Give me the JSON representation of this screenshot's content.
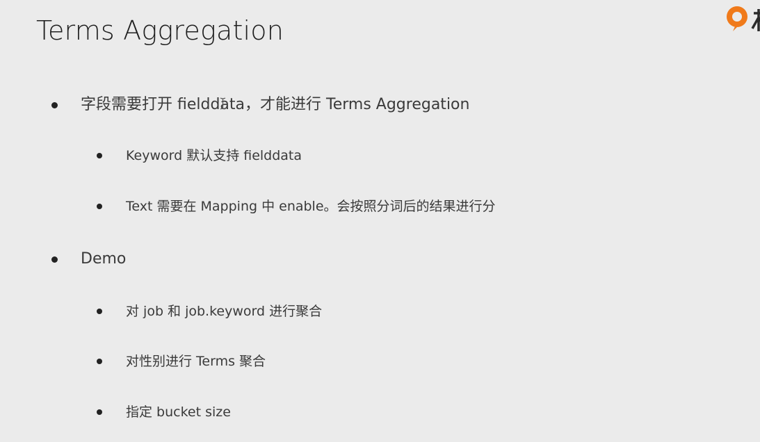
{
  "slide": {
    "title": "Terms Aggregation",
    "logo_icon": "brand-logo-icon",
    "accent_color": "#f07a1a",
    "bullets": [
      {
        "text": "字段需要打开 fielddata，才能进行 Terms Aggregation",
        "children": [
          {
            "text": "Keyword 默认支持 fielddata"
          },
          {
            "text": "Text 需要在 Mapping 中 enable。会按照分词后的结果进行分"
          }
        ]
      },
      {
        "text": "Demo",
        "children": [
          {
            "text": "对 job 和 job.keyword 进行聚合"
          },
          {
            "text": "对性别进行 Terms 聚合"
          },
          {
            "text": "指定 bucket size"
          }
        ]
      }
    ]
  }
}
